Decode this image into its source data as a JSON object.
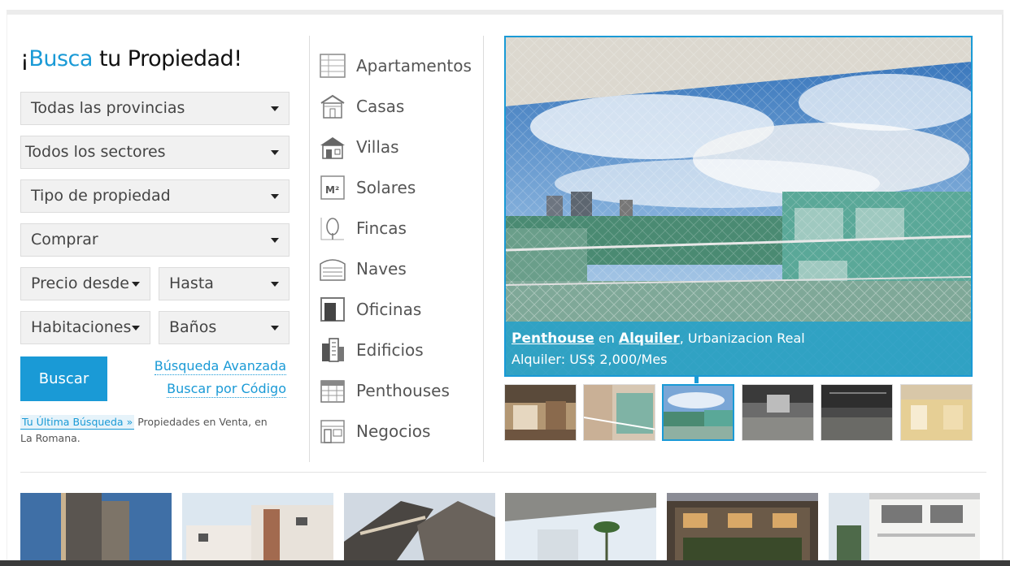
{
  "search": {
    "title_prefix": "¡",
    "title_accent": "Busca",
    "title_rest": " tu Propiedad!",
    "provincia": "Todas las provincias",
    "sector": "Todos los sectores",
    "tipo": "Tipo de propiedad",
    "operacion": "Comprar",
    "precio_desde": "Precio desde",
    "hasta": "Hasta",
    "habitaciones": "Habitaciones",
    "banos": "Baños",
    "buscar_label": "Buscar",
    "avanzada_label": "Búsqueda Avanzada",
    "codigo_label": "Buscar por Código",
    "last_search_link": "Tu Última Búsqueda »",
    "last_search_text": " Propiedades en Venta, en La Romana."
  },
  "categories": [
    {
      "label": "Apartamentos",
      "icon": "apartment-icon"
    },
    {
      "label": "Casas",
      "icon": "house-icon"
    },
    {
      "label": "Villas",
      "icon": "villa-icon"
    },
    {
      "label": "Solares",
      "icon": "lot-m2-icon"
    },
    {
      "label": "Fincas",
      "icon": "tree-icon"
    },
    {
      "label": "Naves",
      "icon": "warehouse-icon"
    },
    {
      "label": "Oficinas",
      "icon": "office-icon"
    },
    {
      "label": "Edificios",
      "icon": "building-icon"
    },
    {
      "label": "Penthouses",
      "icon": "penthouse-icon"
    },
    {
      "label": "Negocios",
      "icon": "store-icon"
    }
  ],
  "featured": {
    "type": "Penthouse",
    "connector": " en ",
    "operation": "Alquiler",
    "location": ", Urbanizacion Real",
    "price": "Alquiler: US$ 2,000/Mes"
  },
  "colors": {
    "accent": "#1a9ad6",
    "caption_bg": "#26a0c8"
  }
}
